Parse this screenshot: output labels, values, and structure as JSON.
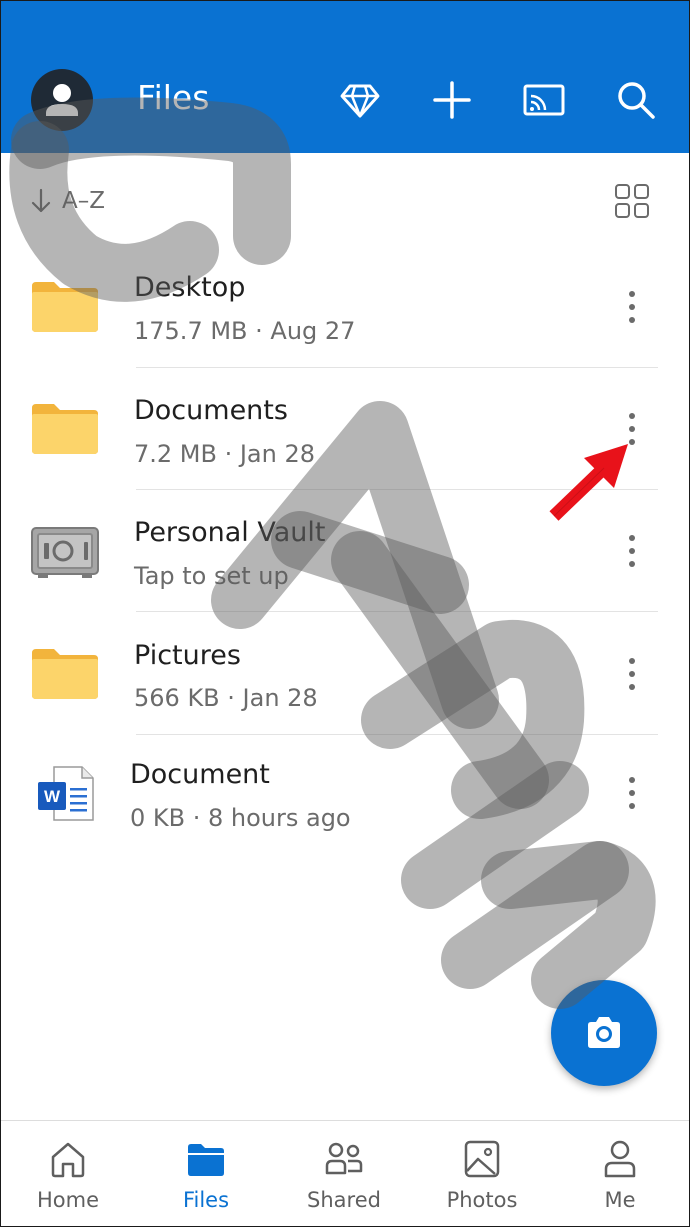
{
  "header": {
    "title": "Files",
    "background": "#0a72d2",
    "icons": [
      "premium-diamond-icon",
      "add-icon",
      "cast-icon",
      "search-icon"
    ]
  },
  "sort": {
    "label": "A–Z",
    "icon": "arrow-down-icon"
  },
  "view_toggle_icon": "grid-view-icon",
  "files": [
    {
      "name": "Desktop",
      "meta": "175.7 MB · Aug 27",
      "icon": "folder-icon"
    },
    {
      "name": "Documents",
      "meta": "7.2 MB · Jan 28",
      "icon": "folder-icon"
    },
    {
      "name": "Personal Vault",
      "meta": "Tap to set up",
      "icon": "vault-icon"
    },
    {
      "name": "Pictures",
      "meta": "566 KB · Jan 28",
      "icon": "folder-icon"
    },
    {
      "name": "Document",
      "meta": "0 KB · 8 hours ago",
      "icon": "word-document-icon"
    }
  ],
  "fab_icon": "camera-icon",
  "nav": {
    "items": [
      {
        "label": "Home",
        "icon": "home-icon"
      },
      {
        "label": "Files",
        "icon": "folder-icon",
        "active": true
      },
      {
        "label": "Shared",
        "icon": "people-icon"
      },
      {
        "label": "Photos",
        "icon": "image-icon"
      },
      {
        "label": "Me",
        "icon": "person-icon"
      }
    ]
  },
  "colors": {
    "accent": "#0a72d2",
    "folder": "#fcd46a",
    "annotation": "#e8121a"
  }
}
